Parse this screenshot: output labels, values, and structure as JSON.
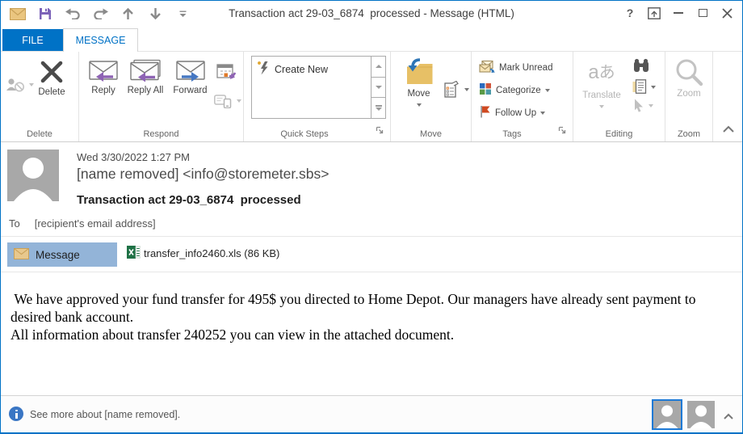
{
  "titlebar": {
    "title": "Transaction act 29-03_6874  processed - Message (HTML)"
  },
  "tabs": {
    "file": "FILE",
    "message": "MESSAGE"
  },
  "ribbon": {
    "delete_group": {
      "label": "Delete",
      "delete_button": "Delete"
    },
    "respond_group": {
      "label": "Respond",
      "reply": "Reply",
      "reply_all": "Reply All",
      "forward": "Forward"
    },
    "quick_steps_group": {
      "label": "Quick Steps",
      "create_new": "Create New"
    },
    "move_group": {
      "label": "Move",
      "move": "Move"
    },
    "tags_group": {
      "label": "Tags",
      "mark_unread": "Mark Unread",
      "categorize": "Categorize",
      "follow_up": "Follow Up"
    },
    "editing_group": {
      "label": "Editing",
      "translate": "Translate"
    },
    "zoom_group": {
      "label": "Zoom",
      "zoom": "Zoom"
    }
  },
  "message": {
    "date": "Wed 3/30/2022 1:27 PM",
    "sender": "[name removed] <info@storemeter.sbs>",
    "subject": "Transaction act 29-03_6874  processed",
    "to_label": "To",
    "to_value": "[recipient's email address]",
    "message_tab": "Message",
    "attachment": "transfer_info2460.xls (86 KB)",
    "body_p1": " We have approved your fund transfer for 495$ you directed to Home Depot. Our managers have already sent payment to desired bank account.",
    "body_p2": "All information about transfer 240252 you can view in the attached document."
  },
  "people_pane": {
    "see_more": "See more about [name removed]."
  },
  "icons": {
    "help": "?",
    "translate_latin": "a",
    "translate_kana": "あ"
  },
  "colors": {
    "accent": "#0072c6",
    "attachment_tab_bg": "#93b4d8",
    "excel_green": "#1e7145",
    "flag_red": "#cf4a21",
    "folder_gold": "#e7c066",
    "reply_purple": "#8e63b4",
    "forward_blue": "#4577c2",
    "save_purple": "#7b62b8",
    "mail_tan": "#eac57f"
  }
}
